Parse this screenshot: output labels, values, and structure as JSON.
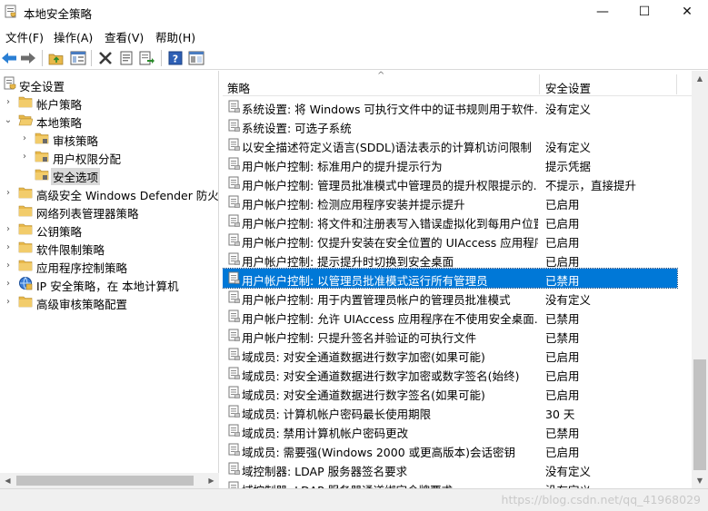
{
  "window": {
    "title": "本地安全策略",
    "minimize": "—",
    "maximize": "☐",
    "close": "✕"
  },
  "menu": [
    "文件(F)",
    "操作(A)",
    "查看(V)",
    "帮助(H)"
  ],
  "toolbar": [
    "back-arrow-icon",
    "forward-arrow-icon",
    "up-folder-icon",
    "show-tree-icon",
    "delete-icon",
    "properties-icon",
    "export-list-icon",
    "help-icon",
    "console-icon"
  ],
  "tree": [
    {
      "label": "安全设置",
      "level": 0,
      "arrow": "",
      "icon": "security"
    },
    {
      "label": "帐户策略",
      "level": 1,
      "arrow": "›",
      "icon": "folder"
    },
    {
      "label": "本地策略",
      "level": 1,
      "arrow": "⌄",
      "icon": "folder-open"
    },
    {
      "label": "审核策略",
      "level": 2,
      "arrow": "›",
      "icon": "folder"
    },
    {
      "label": "用户权限分配",
      "level": 2,
      "arrow": "›",
      "icon": "folder"
    },
    {
      "label": "安全选项",
      "level": 2,
      "arrow": "",
      "icon": "folder",
      "selected": true
    },
    {
      "label": "高级安全 Windows Defender 防火墙",
      "level": 1,
      "arrow": "›",
      "icon": "folder"
    },
    {
      "label": "网络列表管理器策略",
      "level": 1,
      "arrow": "",
      "icon": "folder"
    },
    {
      "label": "公钥策略",
      "level": 1,
      "arrow": "›",
      "icon": "folder"
    },
    {
      "label": "软件限制策略",
      "level": 1,
      "arrow": "›",
      "icon": "folder"
    },
    {
      "label": "应用程序控制策略",
      "level": 1,
      "arrow": "›",
      "icon": "folder"
    },
    {
      "label": "IP 安全策略，在 本地计算机",
      "level": 1,
      "arrow": "›",
      "icon": "ipsec"
    },
    {
      "label": "高级审核策略配置",
      "level": 1,
      "arrow": "›",
      "icon": "folder"
    }
  ],
  "list": {
    "columns": {
      "policy": "策略",
      "setting": "安全设置",
      "sort_indicator": "^"
    },
    "rows": [
      {
        "policy": "系统设置: 将 Windows 可执行文件中的证书规则用于软件...",
        "setting": "没有定义"
      },
      {
        "policy": "系统设置: 可选子系统",
        "setting": ""
      },
      {
        "policy": "以安全描述符定义语言(SDDL)语法表示的计算机访问限制",
        "setting": "没有定义"
      },
      {
        "policy": "用户帐户控制: 标准用户的提升提示行为",
        "setting": "提示凭据"
      },
      {
        "policy": "用户帐户控制: 管理员批准模式中管理员的提升权限提示的...",
        "setting": "不提示，直接提升"
      },
      {
        "policy": "用户帐户控制: 检测应用程序安装并提示提升",
        "setting": "已启用"
      },
      {
        "policy": "用户帐户控制: 将文件和注册表写入错误虚拟化到每用户位置",
        "setting": "已启用"
      },
      {
        "policy": "用户帐户控制: 仅提升安装在安全位置的 UIAccess 应用程序",
        "setting": "已启用"
      },
      {
        "policy": "用户帐户控制: 提示提升时切换到安全桌面",
        "setting": "已启用"
      },
      {
        "policy": "用户帐户控制: 以管理员批准模式运行所有管理员",
        "setting": "已禁用",
        "selected": true
      },
      {
        "policy": "用户帐户控制: 用于内置管理员帐户的管理员批准模式",
        "setting": "没有定义"
      },
      {
        "policy": "用户帐户控制: 允许 UIAccess 应用程序在不使用安全桌面...",
        "setting": "已禁用"
      },
      {
        "policy": "用户帐户控制: 只提升签名并验证的可执行文件",
        "setting": "已禁用"
      },
      {
        "policy": "域成员: 对安全通道数据进行数字加密(如果可能)",
        "setting": "已启用"
      },
      {
        "policy": "域成员: 对安全通道数据进行数字加密或数字签名(始终)",
        "setting": "已启用"
      },
      {
        "policy": "域成员: 对安全通道数据进行数字签名(如果可能)",
        "setting": "已启用"
      },
      {
        "policy": "域成员: 计算机帐户密码最长使用期限",
        "setting": "30 天"
      },
      {
        "policy": "域成员: 禁用计算机帐户密码更改",
        "setting": "已禁用"
      },
      {
        "policy": "域成员: 需要强(Windows 2000 或更高版本)会话密钥",
        "setting": "已启用"
      },
      {
        "policy": "域控制器: LDAP 服务器签名要求",
        "setting": "没有定义"
      },
      {
        "policy": "域控制器: LDAP 服务器通道绑定令牌要求",
        "setting": "没有定义"
      }
    ]
  },
  "status": {
    "watermark": "https://blog.csdn.net/qq_41968029"
  },
  "colors": {
    "selection": "#0078d7",
    "folder": "#e8b84a",
    "tree_selected": "#d9d9d9"
  }
}
